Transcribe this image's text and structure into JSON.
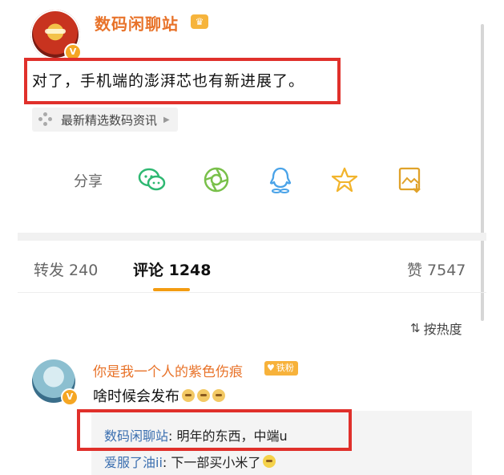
{
  "post": {
    "author": "数码闲聊站",
    "text": "对了，手机端的澎湃芯也有新进展了。",
    "topic": "最新精选数码资讯",
    "verified_mark": "V"
  },
  "share": {
    "label": "分享",
    "icons": [
      "wechat-icon",
      "moments-icon",
      "qq-icon",
      "qzone-icon",
      "save-image-icon"
    ]
  },
  "tabs": {
    "repost": "转发 240",
    "comments": "评论 1248",
    "likes": "赞 7547"
  },
  "sort": {
    "label": "按热度"
  },
  "comment": {
    "author": "你是我一个人的紫色伤痕",
    "badge": "铁粉",
    "text": "啥时候会发布",
    "replies": [
      {
        "who": "数码闲聊站",
        "text": ": 明年的东西，中端u"
      },
      {
        "who": "爱服了油ii",
        "text": ": 下一部买小米了"
      }
    ]
  },
  "colors": {
    "accent": "#e8732a",
    "highlight_box": "#e0302b",
    "tab_underline": "#f39c12",
    "reply_name": "#3b6fb0"
  }
}
